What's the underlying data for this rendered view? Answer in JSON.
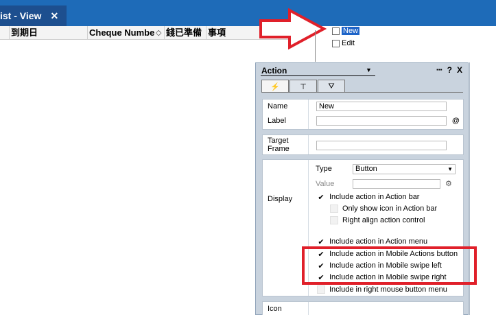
{
  "tab": {
    "title": "ist - View",
    "close": "✕"
  },
  "columns": [
    {
      "label": "到期日"
    },
    {
      "label": "Cheque Numbe"
    },
    {
      "label": "錢已準備"
    },
    {
      "label": "事項"
    }
  ],
  "mini_menu": {
    "new_label": "New",
    "edit_label": "Edit"
  },
  "panel": {
    "title": "Action",
    "tools": {
      "menu": "▪▪▪",
      "help": "?",
      "close": "X"
    },
    "tabs": [
      "⚡",
      "⊤",
      "⛛"
    ],
    "name_label": "Name",
    "name_value": "New",
    "label_label": "Label",
    "label_at": "@",
    "target_label": "Target\nFrame",
    "display_label": "Display",
    "type_label": "Type",
    "type_value": "Button",
    "value_label": "Value",
    "options": [
      {
        "label": "Include action in Action bar",
        "checked": true,
        "indent": false
      },
      {
        "label": "Only show icon in Action bar",
        "checked": false,
        "indent": true
      },
      {
        "label": "Right align action control",
        "checked": false,
        "indent": true
      },
      {
        "label": "Include action in Action menu",
        "checked": true,
        "indent": false
      },
      {
        "label": "Include action in Mobile Actions button",
        "checked": true,
        "indent": false
      },
      {
        "label": "Include action in Mobile swipe left",
        "checked": true,
        "indent": false
      },
      {
        "label": "Include action in Mobile swipe right",
        "checked": true,
        "indent": false
      },
      {
        "label": "Include in right mouse button menu",
        "checked": false,
        "indent": false
      }
    ],
    "icon_label": "Icon"
  },
  "colors": {
    "accent": "#1e6bb8",
    "highlight": "#e0202a",
    "panel_bg": "#c9d3de"
  }
}
